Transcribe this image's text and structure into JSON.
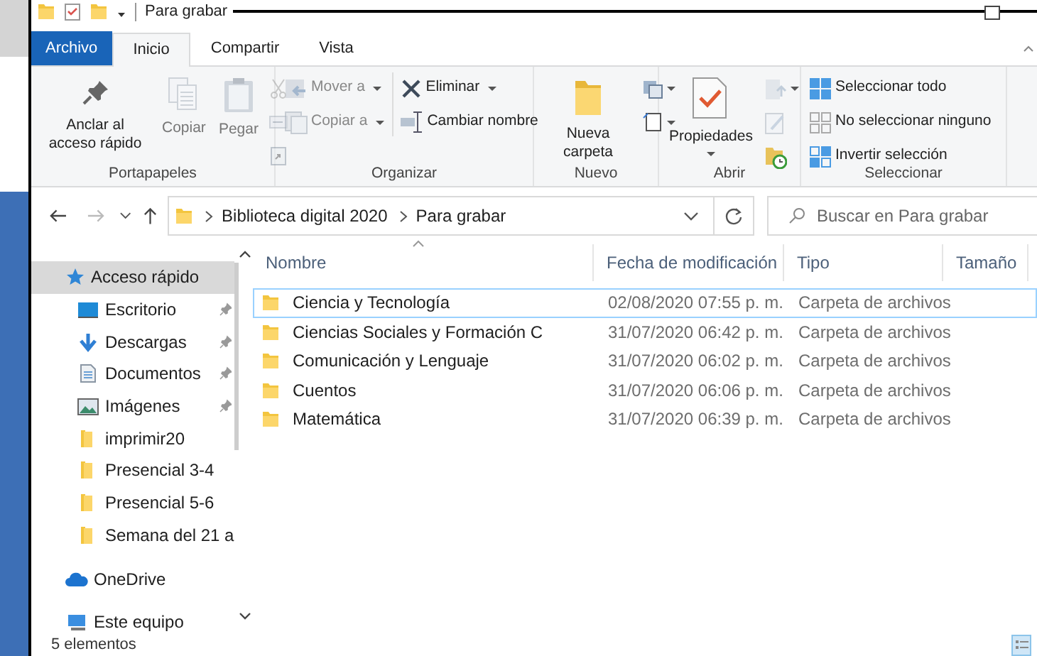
{
  "window": {
    "title": "Para grabar"
  },
  "tabs": [
    {
      "label": "Archivo",
      "kind": "file",
      "selected": false
    },
    {
      "label": "Inicio",
      "kind": "tab",
      "selected": true
    },
    {
      "label": "Compartir",
      "kind": "tab",
      "selected": false
    },
    {
      "label": "Vista",
      "kind": "tab",
      "selected": false
    }
  ],
  "ribbon": {
    "groups": [
      {
        "label": "Portapapeles",
        "columns": [
          {
            "items": [
              {
                "kind": "large",
                "label": "Anclar al acceso rápido",
                "disabled": false,
                "dropdown": false
              }
            ]
          },
          {
            "items": [
              {
                "kind": "large",
                "label": "Copiar",
                "disabled": true,
                "dropdown": false
              }
            ]
          },
          {
            "items": [
              {
                "kind": "large",
                "label": "Pegar",
                "disabled": true,
                "dropdown": false
              }
            ]
          },
          {
            "items": [
              {
                "kind": "icon",
                "disabled": true,
                "dropdown": false
              },
              {
                "kind": "icon",
                "disabled": true,
                "dropdown": false
              },
              {
                "kind": "icon",
                "disabled": true,
                "dropdown": false
              }
            ]
          }
        ]
      },
      {
        "label": "Organizar",
        "columns": [
          {
            "items": [
              {
                "kind": "small",
                "label": "Mover a",
                "disabled": true,
                "dropdown": true
              },
              {
                "kind": "small",
                "label": "Copiar a",
                "disabled": true,
                "dropdown": true
              }
            ]
          },
          {
            "items": [
              {
                "kind": "small",
                "label": "Eliminar",
                "disabled": false,
                "dropdown": true
              },
              {
                "kind": "small",
                "label": "Cambiar nombre",
                "disabled": false,
                "dropdown": false
              }
            ]
          }
        ]
      },
      {
        "label": "Nuevo",
        "columns": [
          {
            "items": [
              {
                "kind": "large",
                "label": "Nueva carpeta",
                "disabled": false,
                "dropdown": false
              }
            ]
          },
          {
            "items": [
              {
                "kind": "icon",
                "disabled": false,
                "dropdown": true
              },
              {
                "kind": "icon",
                "disabled": false,
                "dropdown": true
              }
            ]
          }
        ]
      },
      {
        "label": "Abrir",
        "columns": [
          {
            "items": [
              {
                "kind": "large",
                "label": "Propiedades",
                "disabled": false,
                "dropdown": true
              }
            ]
          },
          {
            "items": [
              {
                "kind": "icon",
                "disabled": true,
                "dropdown": true
              },
              {
                "kind": "icon",
                "disabled": true,
                "dropdown": false
              },
              {
                "kind": "icon",
                "disabled": false,
                "dropdown": false
              }
            ]
          }
        ]
      },
      {
        "label": "Seleccionar",
        "columns": [
          {
            "items": [
              {
                "kind": "small",
                "label": "Seleccionar todo",
                "disabled": false,
                "dropdown": false
              },
              {
                "kind": "small",
                "label": "No seleccionar ninguno",
                "disabled": false,
                "dropdown": false
              },
              {
                "kind": "small",
                "label": "Invertir selección",
                "disabled": false,
                "dropdown": false
              }
            ]
          }
        ]
      }
    ]
  },
  "address": {
    "path": [
      "Biblioteca digital 2020",
      "Para grabar"
    ],
    "search_placeholder": "Buscar en Para grabar"
  },
  "sidebar": {
    "items": [
      {
        "label": "Acceso rápido",
        "kind": "star",
        "selected": true,
        "children": [
          {
            "label": "Escritorio",
            "kind": "desktop",
            "pinned": true,
            "selected": false
          },
          {
            "label": "Descargas",
            "kind": "download",
            "pinned": true,
            "selected": false
          },
          {
            "label": "Documentos",
            "kind": "document",
            "pinned": true,
            "selected": false
          },
          {
            "label": "Imágenes",
            "kind": "image",
            "pinned": true,
            "selected": false
          },
          {
            "label": "imprimir20",
            "kind": "folder",
            "pinned": false,
            "selected": false
          },
          {
            "label": "Presencial 3-4",
            "kind": "folder",
            "pinned": false,
            "selected": false
          },
          {
            "label": "Presencial 5-6",
            "kind": "folder",
            "pinned": false,
            "selected": false
          },
          {
            "label": "Semana del 21 a",
            "kind": "folder",
            "pinned": false,
            "selected": false
          }
        ]
      },
      {
        "label": "OneDrive",
        "kind": "cloud",
        "selected": false
      },
      {
        "label": "Este equipo",
        "kind": "computer",
        "selected": false
      }
    ]
  },
  "table": {
    "columns": [
      "Nombre",
      "Fecha de modificación",
      "Tipo",
      "Tamaño"
    ],
    "rows": [
      {
        "name": "Ciencia y Tecnología",
        "date": "02/08/2020 07:55 p. m.",
        "type": "Carpeta de archivos",
        "focused": true
      },
      {
        "name": "Ciencias Sociales y Formación C",
        "date": "31/07/2020 06:42 p. m.",
        "type": "Carpeta de archivos",
        "focused": false
      },
      {
        "name": "Comunicación y Lenguaje",
        "date": "31/07/2020 06:02 p. m.",
        "type": "Carpeta de archivos",
        "focused": false
      },
      {
        "name": "Cuentos",
        "date": "31/07/2020 06:06 p. m.",
        "type": "Carpeta de archivos",
        "focused": false
      },
      {
        "name": "Matemática",
        "date": "31/07/2020 06:39 p. m.",
        "type": "Carpeta de archivos",
        "focused": false
      }
    ]
  },
  "status_bar": {
    "text": "5 elementos"
  }
}
